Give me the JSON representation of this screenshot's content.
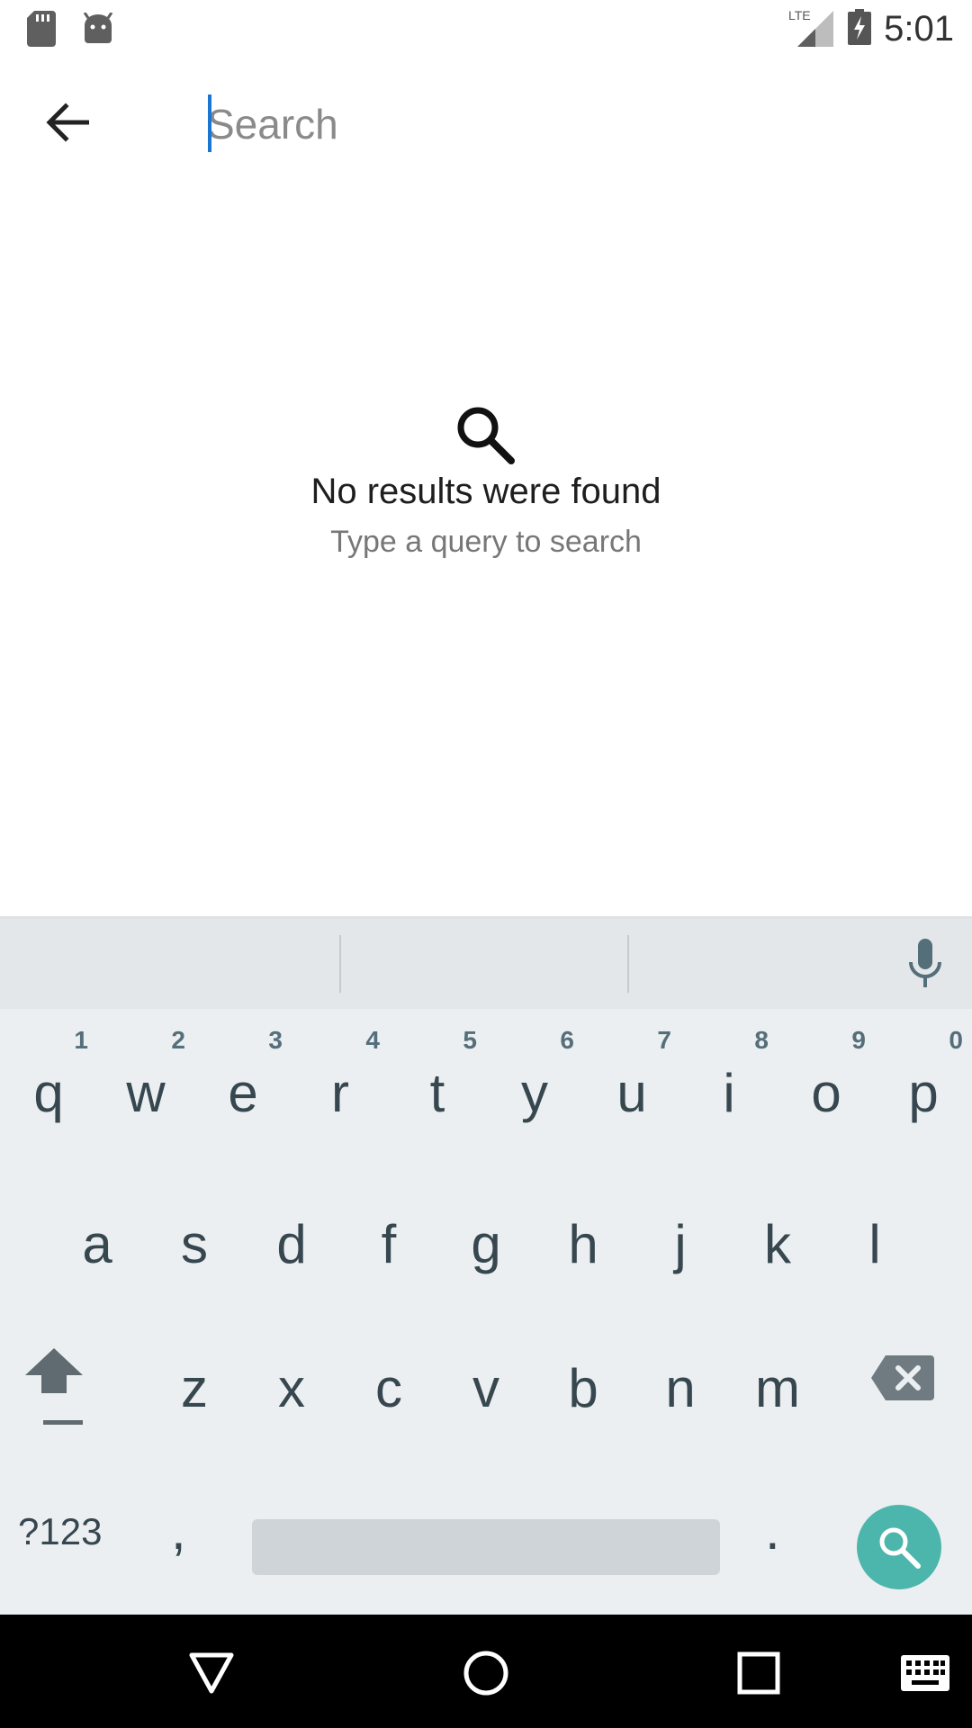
{
  "status_bar": {
    "time": "5:01",
    "network": "LTE",
    "icons": [
      "sd-card-icon",
      "android-icon",
      "signal-icon",
      "battery-charging-icon"
    ]
  },
  "header": {
    "back_icon": "arrow-back-icon",
    "search_placeholder": "Search",
    "search_value": ""
  },
  "empty_state": {
    "icon": "search-icon",
    "title": "No results were found",
    "subtitle": "Type a query to search"
  },
  "keyboard": {
    "row1": [
      {
        "char": "q",
        "hint": "1"
      },
      {
        "char": "w",
        "hint": "2"
      },
      {
        "char": "e",
        "hint": "3"
      },
      {
        "char": "r",
        "hint": "4"
      },
      {
        "char": "t",
        "hint": "5"
      },
      {
        "char": "y",
        "hint": "6"
      },
      {
        "char": "u",
        "hint": "7"
      },
      {
        "char": "i",
        "hint": "8"
      },
      {
        "char": "o",
        "hint": "9"
      },
      {
        "char": "p",
        "hint": "0"
      }
    ],
    "row2": [
      "a",
      "s",
      "d",
      "f",
      "g",
      "h",
      "j",
      "k",
      "l"
    ],
    "row3": [
      "z",
      "x",
      "c",
      "v",
      "b",
      "n",
      "m"
    ],
    "symbols_label": "?123",
    "comma": ",",
    "period": ".",
    "accent_color": "#4db6ac"
  },
  "nav_bar": {
    "icons": [
      "back-triangle-icon",
      "home-circle-icon",
      "recents-square-icon",
      "keyboard-icon"
    ]
  }
}
